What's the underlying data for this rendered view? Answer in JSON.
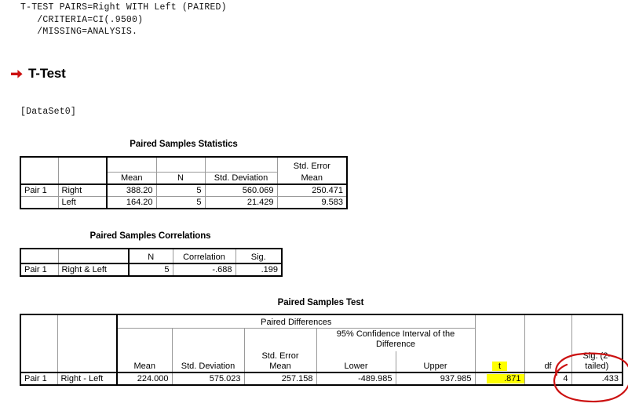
{
  "syntax": {
    "lines": "T-TEST PAIRS=Right WITH Left (PAIRED)\n   /CRITERIA=CI(.9500)\n   /MISSING=ANALYSIS."
  },
  "heading": {
    "icon": "red-right-arrow-icon",
    "text": "T-Test"
  },
  "dataset_label": "[DataSet0]",
  "tables": {
    "paired_samples_statistics": {
      "title": "Paired Samples Statistics",
      "columns": [
        "",
        "",
        "Mean",
        "N",
        "Std. Deviation",
        "Std. Error\nMean"
      ],
      "col_std_error_line1": "Std. Error",
      "col_std_error_line2": "Mean",
      "rows": [
        {
          "pair": "Pair 1",
          "variable": "Right",
          "mean": "388.20",
          "n": "5",
          "std_deviation": "560.069",
          "std_error_mean": "250.471"
        },
        {
          "pair": "",
          "variable": "Left",
          "mean": "164.20",
          "n": "5",
          "std_deviation": "21.429",
          "std_error_mean": "9.583"
        }
      ]
    },
    "paired_samples_correlations": {
      "title": "Paired Samples Correlations",
      "columns": [
        "",
        "",
        "N",
        "Correlation",
        "Sig."
      ],
      "rows": [
        {
          "pair": "Pair 1",
          "variable": "Right & Left",
          "n": "5",
          "correlation": "-.688",
          "sig": ".199"
        }
      ]
    },
    "paired_samples_test": {
      "title": "Paired Samples Test",
      "group_header": "Paired Differences",
      "ci_header_line1": "95% Confidence Interval of the",
      "ci_header_line2": "Difference",
      "columns": {
        "mean": "Mean",
        "std_deviation": "Std. Deviation",
        "std_error_mean_line1": "Std. Error",
        "std_error_mean_line2": "Mean",
        "lower": "Lower",
        "upper": "Upper",
        "t": "t",
        "df": "df",
        "sig_2tailed": "Sig. (2-tailed)"
      },
      "rows": [
        {
          "pair": "Pair 1",
          "variable": "Right - Left",
          "mean": "224.000",
          "std_deviation": "575.023",
          "std_error_mean": "257.158",
          "lower": "-489.985",
          "upper": "937.985",
          "t": ".871",
          "df": "4",
          "sig_2tailed": ".433"
        }
      ]
    }
  },
  "annotations": {
    "highlight_color": "#ffff00",
    "circle_color": "#cc1111",
    "highlighted_cells": [
      "t-header",
      "t-value"
    ],
    "circled_column": "Sig. (2-tailed)"
  }
}
